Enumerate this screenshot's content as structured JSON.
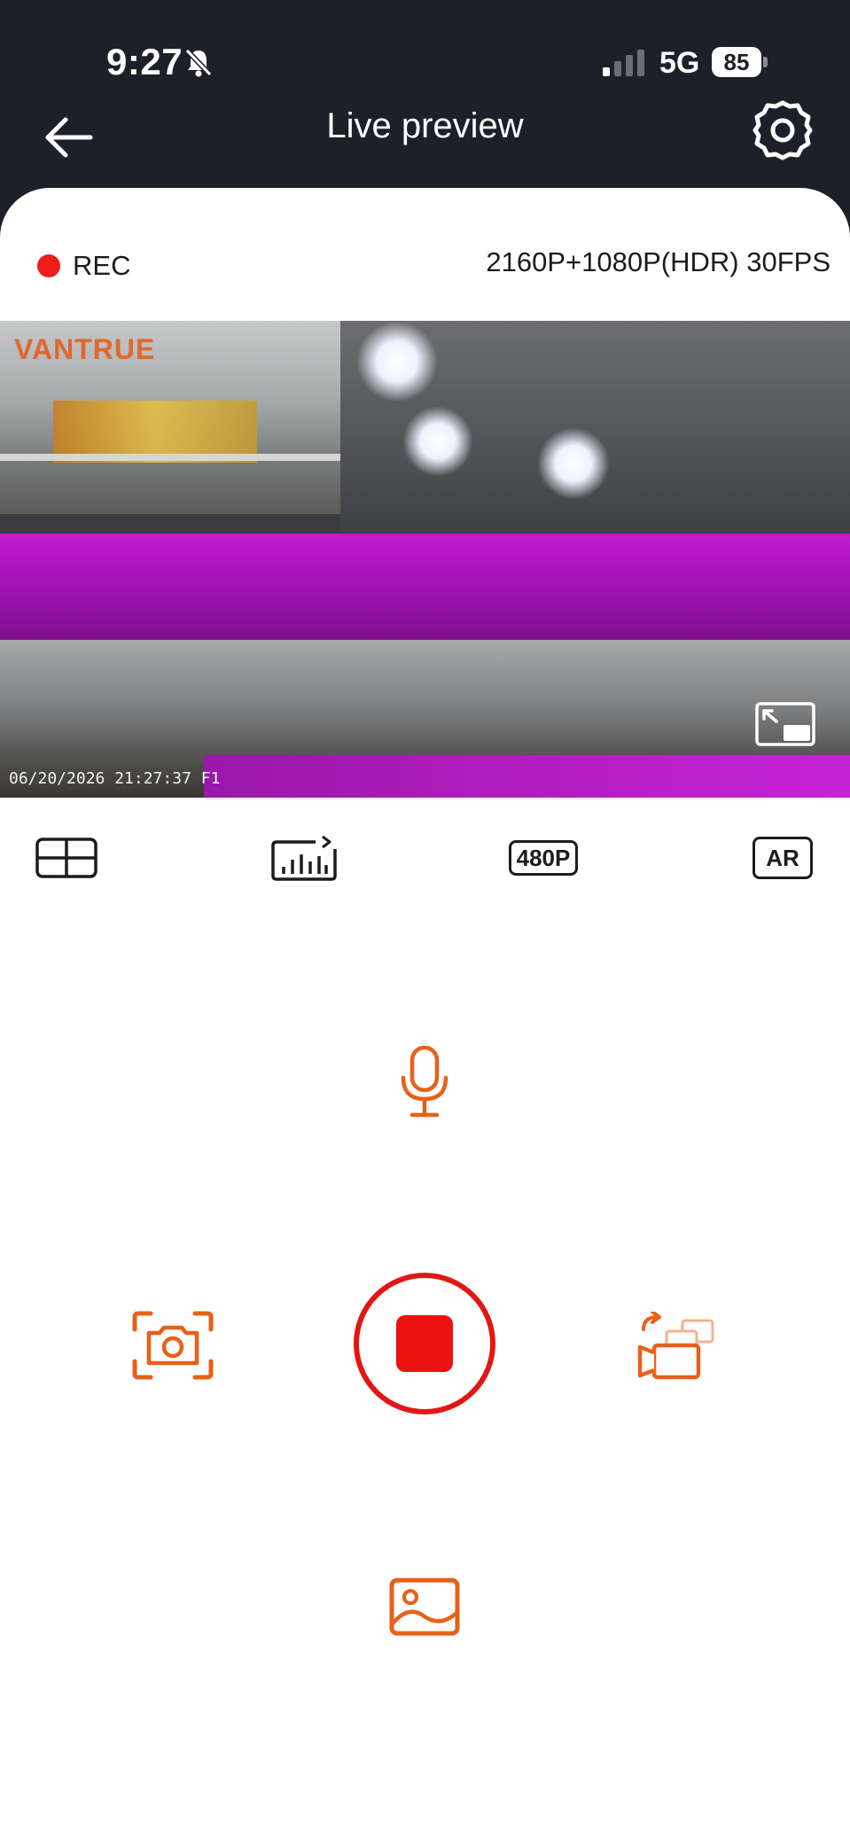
{
  "status_bar": {
    "time": "9:27",
    "network": "5G",
    "battery": "85",
    "icons": [
      "bell-slash-icon",
      "signal-icon",
      "battery-icon"
    ]
  },
  "header": {
    "title": "Live preview",
    "back_icon": "arrow-left-icon",
    "settings_icon": "gear-icon"
  },
  "recording": {
    "label": "REC",
    "resolution": "2160P+1080P(HDR) 30FPS"
  },
  "feed": {
    "brand_watermark": "VANTRUE",
    "timestamp": "06/20/2026  21:27:37  F1",
    "fullscreen_icon": "fullscreen-exit-icon"
  },
  "toolbar": {
    "layout_icon": "grid-layout-icon",
    "bitrate_icon": "signal-bars-icon",
    "quality_label": "480P",
    "ar_label": "AR"
  },
  "controls": {
    "mic_icon": "microphone-icon",
    "snapshot_icon": "camera-snapshot-icon",
    "record_icon": "stop-record-icon",
    "switch_icon": "switch-camera-icon",
    "gallery_icon": "gallery-icon"
  },
  "colors": {
    "accent": "#e8601a",
    "record": "#e21616",
    "header_bg": "#1e2029"
  }
}
